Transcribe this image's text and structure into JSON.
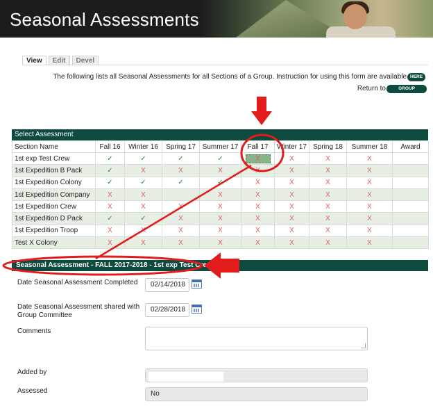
{
  "header": {
    "title": "Seasonal Assessments"
  },
  "tabs": [
    {
      "label": "View",
      "active": true
    },
    {
      "label": "Edit",
      "active": false
    },
    {
      "label": "Devel",
      "active": false
    }
  ],
  "info": {
    "line1": "The following lists all Seasonal Assessments for all Sections of a Group. Instruction for using this form are available",
    "here_label": "HERE",
    "line2": "Return to",
    "group_profile_label": "GROUP PROFILE"
  },
  "assessment_table": {
    "title": "Select Assessment",
    "columns": [
      "Section Name",
      "Fall 16",
      "Winter 16",
      "Spring 17",
      "Summer 17",
      "Fall 17",
      "Winter 17",
      "Spring 18",
      "Summer 18",
      "Award"
    ],
    "rows": [
      {
        "name": "1st exp Test Crew",
        "marks": [
          "check",
          "check",
          "check",
          "check",
          "selected",
          "cross",
          "cross",
          "cross",
          ""
        ]
      },
      {
        "name": "1st Expedition B Pack",
        "marks": [
          "check",
          "cross",
          "cross",
          "cross",
          "cross",
          "cross",
          "cross",
          "cross",
          ""
        ]
      },
      {
        "name": "1st Expedition Colony",
        "marks": [
          "check",
          "check",
          "check",
          "check",
          "cross",
          "cross",
          "cross",
          "cross",
          ""
        ]
      },
      {
        "name": "1st Expedition Company",
        "marks": [
          "cross",
          "cross",
          "",
          "cross",
          "cross",
          "cross",
          "cross",
          "cross",
          ""
        ]
      },
      {
        "name": "1st Expedition Crew",
        "marks": [
          "cross",
          "cross",
          "cross",
          "cross",
          "cross",
          "cross",
          "cross",
          "cross",
          ""
        ]
      },
      {
        "name": "1st Expedition D Pack",
        "marks": [
          "check",
          "check",
          "cross",
          "cross",
          "cross",
          "cross",
          "cross",
          "cross",
          ""
        ]
      },
      {
        "name": "1st Expedition Troop",
        "marks": [
          "cross",
          "cross",
          "cross",
          "cross",
          "cross",
          "cross",
          "cross",
          "cross",
          ""
        ]
      },
      {
        "name": "Test X Colony",
        "marks": [
          "cross",
          "cross",
          "cross",
          "cross",
          "cross",
          "cross",
          "cross",
          "cross",
          ""
        ]
      }
    ],
    "check_symbol": "✓",
    "cross_symbol": "X"
  },
  "form": {
    "title": "Seasonal Assessment - FALL 2017-2018 - 1st exp Test Crew",
    "date_completed_label": "Date Seasonal Assessment Completed",
    "date_completed_value": "02/14/2018",
    "date_shared_label_1": "Date Seasonal Assessment shared with",
    "date_shared_label_2": "Group Committee",
    "date_shared_value": "02/28/2018",
    "comments_label": "Comments",
    "comments_value": "",
    "added_by_label": "Added by",
    "added_by_value": "",
    "assessed_label": "Assessed",
    "assessed_value": "No"
  },
  "colors": {
    "header_green": "#0e4a3d",
    "check_green": "#2d8a2d",
    "cross_red": "#e45a5a",
    "annotation_red": "#e21b1b",
    "row_alt": "#e7eee4"
  }
}
